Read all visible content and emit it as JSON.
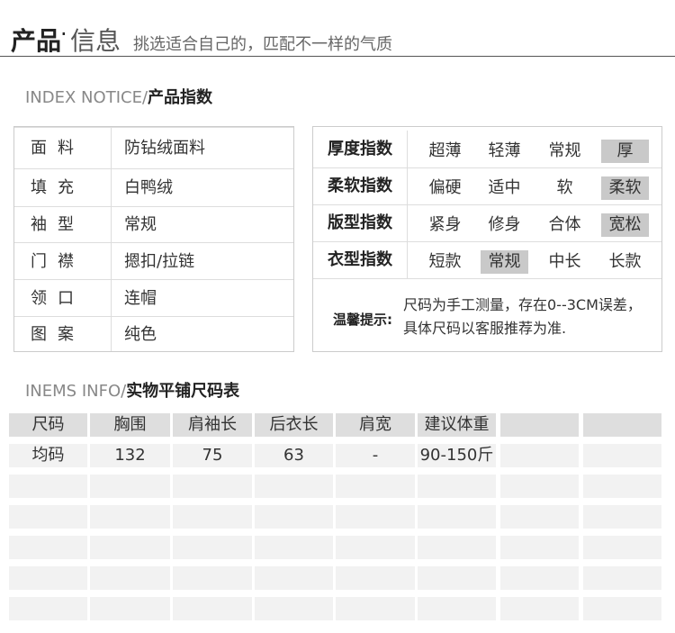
{
  "header": {
    "title_part1": "产品",
    "title_dot": "·",
    "title_part2": "信息",
    "subtitle": "挑选适合自己的，匹配不一样的气质"
  },
  "index_section": {
    "en": "INDEX NOTICE/",
    "cn": "产品指数"
  },
  "specs": [
    {
      "label": "面料",
      "value": "防钻绒面料"
    },
    {
      "label": "填充",
      "value": "白鸭绒"
    },
    {
      "label": "袖型",
      "value": "常规"
    },
    {
      "label": "门襟",
      "value": "摁扣/拉链"
    },
    {
      "label": "领口",
      "value": "连帽"
    },
    {
      "label": "图案",
      "value": "纯色"
    }
  ],
  "indices": [
    {
      "name": "厚度指数",
      "options": [
        "超薄",
        "轻薄",
        "常规",
        "厚"
      ],
      "selected": 3
    },
    {
      "name": "柔软指数",
      "options": [
        "偏硬",
        "适中",
        "软",
        "柔软"
      ],
      "selected": 3
    },
    {
      "name": "版型指数",
      "options": [
        "紧身",
        "修身",
        "合体",
        "宽松"
      ],
      "selected": 3
    },
    {
      "name": "衣型指数",
      "options": [
        "短款",
        "常规",
        "中长",
        "长款"
      ],
      "selected": 1
    }
  ],
  "tip": {
    "label": "温馨提示:",
    "line1": "尺码为手工测量，存在0--3CM误差，",
    "line2": "具体尺码以客服推荐为准."
  },
  "size_section": {
    "en": "INEMS INFO/",
    "cn": "实物平铺尺码表"
  },
  "size_table": {
    "headers": [
      "尺码",
      "胸围",
      "肩袖长",
      "后衣长",
      "肩宽",
      "建议体重",
      "",
      ""
    ],
    "rows": [
      [
        "均码",
        "132",
        "75",
        "63",
        "-",
        "90-150斤",
        "",
        ""
      ],
      [
        "",
        "",
        "",
        "",
        "",
        "",
        "",
        ""
      ],
      [
        "",
        "",
        "",
        "",
        "",
        "",
        "",
        ""
      ],
      [
        "",
        "",
        "",
        "",
        "",
        "",
        "",
        ""
      ],
      [
        "",
        "",
        "",
        "",
        "",
        "",
        "",
        ""
      ],
      [
        "",
        "",
        "",
        "",
        "",
        "",
        "",
        ""
      ]
    ]
  }
}
